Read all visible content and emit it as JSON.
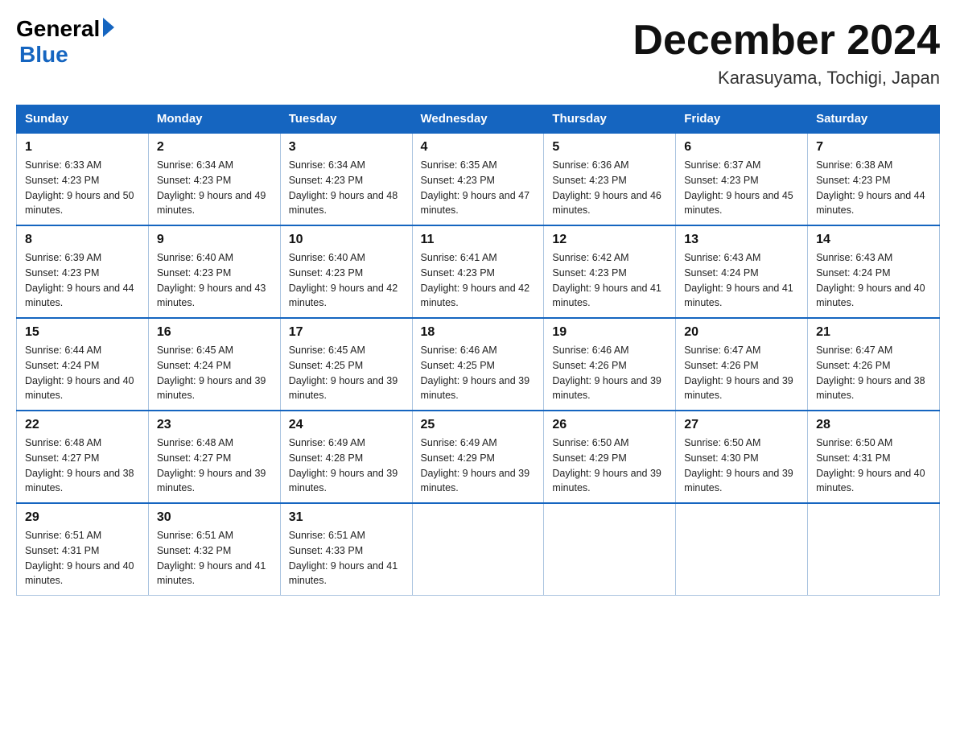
{
  "header": {
    "logo_general": "General",
    "logo_blue": "Blue",
    "title": "December 2024",
    "subtitle": "Karasuyama, Tochigi, Japan"
  },
  "days_of_week": [
    "Sunday",
    "Monday",
    "Tuesday",
    "Wednesday",
    "Thursday",
    "Friday",
    "Saturday"
  ],
  "weeks": [
    [
      {
        "day": 1,
        "sunrise": "6:33 AM",
        "sunset": "4:23 PM",
        "daylight": "9 hours and 50 minutes."
      },
      {
        "day": 2,
        "sunrise": "6:34 AM",
        "sunset": "4:23 PM",
        "daylight": "9 hours and 49 minutes."
      },
      {
        "day": 3,
        "sunrise": "6:34 AM",
        "sunset": "4:23 PM",
        "daylight": "9 hours and 48 minutes."
      },
      {
        "day": 4,
        "sunrise": "6:35 AM",
        "sunset": "4:23 PM",
        "daylight": "9 hours and 47 minutes."
      },
      {
        "day": 5,
        "sunrise": "6:36 AM",
        "sunset": "4:23 PM",
        "daylight": "9 hours and 46 minutes."
      },
      {
        "day": 6,
        "sunrise": "6:37 AM",
        "sunset": "4:23 PM",
        "daylight": "9 hours and 45 minutes."
      },
      {
        "day": 7,
        "sunrise": "6:38 AM",
        "sunset": "4:23 PM",
        "daylight": "9 hours and 44 minutes."
      }
    ],
    [
      {
        "day": 8,
        "sunrise": "6:39 AM",
        "sunset": "4:23 PM",
        "daylight": "9 hours and 44 minutes."
      },
      {
        "day": 9,
        "sunrise": "6:40 AM",
        "sunset": "4:23 PM",
        "daylight": "9 hours and 43 minutes."
      },
      {
        "day": 10,
        "sunrise": "6:40 AM",
        "sunset": "4:23 PM",
        "daylight": "9 hours and 42 minutes."
      },
      {
        "day": 11,
        "sunrise": "6:41 AM",
        "sunset": "4:23 PM",
        "daylight": "9 hours and 42 minutes."
      },
      {
        "day": 12,
        "sunrise": "6:42 AM",
        "sunset": "4:23 PM",
        "daylight": "9 hours and 41 minutes."
      },
      {
        "day": 13,
        "sunrise": "6:43 AM",
        "sunset": "4:24 PM",
        "daylight": "9 hours and 41 minutes."
      },
      {
        "day": 14,
        "sunrise": "6:43 AM",
        "sunset": "4:24 PM",
        "daylight": "9 hours and 40 minutes."
      }
    ],
    [
      {
        "day": 15,
        "sunrise": "6:44 AM",
        "sunset": "4:24 PM",
        "daylight": "9 hours and 40 minutes."
      },
      {
        "day": 16,
        "sunrise": "6:45 AM",
        "sunset": "4:24 PM",
        "daylight": "9 hours and 39 minutes."
      },
      {
        "day": 17,
        "sunrise": "6:45 AM",
        "sunset": "4:25 PM",
        "daylight": "9 hours and 39 minutes."
      },
      {
        "day": 18,
        "sunrise": "6:46 AM",
        "sunset": "4:25 PM",
        "daylight": "9 hours and 39 minutes."
      },
      {
        "day": 19,
        "sunrise": "6:46 AM",
        "sunset": "4:26 PM",
        "daylight": "9 hours and 39 minutes."
      },
      {
        "day": 20,
        "sunrise": "6:47 AM",
        "sunset": "4:26 PM",
        "daylight": "9 hours and 39 minutes."
      },
      {
        "day": 21,
        "sunrise": "6:47 AM",
        "sunset": "4:26 PM",
        "daylight": "9 hours and 38 minutes."
      }
    ],
    [
      {
        "day": 22,
        "sunrise": "6:48 AM",
        "sunset": "4:27 PM",
        "daylight": "9 hours and 38 minutes."
      },
      {
        "day": 23,
        "sunrise": "6:48 AM",
        "sunset": "4:27 PM",
        "daylight": "9 hours and 39 minutes."
      },
      {
        "day": 24,
        "sunrise": "6:49 AM",
        "sunset": "4:28 PM",
        "daylight": "9 hours and 39 minutes."
      },
      {
        "day": 25,
        "sunrise": "6:49 AM",
        "sunset": "4:29 PM",
        "daylight": "9 hours and 39 minutes."
      },
      {
        "day": 26,
        "sunrise": "6:50 AM",
        "sunset": "4:29 PM",
        "daylight": "9 hours and 39 minutes."
      },
      {
        "day": 27,
        "sunrise": "6:50 AM",
        "sunset": "4:30 PM",
        "daylight": "9 hours and 39 minutes."
      },
      {
        "day": 28,
        "sunrise": "6:50 AM",
        "sunset": "4:31 PM",
        "daylight": "9 hours and 40 minutes."
      }
    ],
    [
      {
        "day": 29,
        "sunrise": "6:51 AM",
        "sunset": "4:31 PM",
        "daylight": "9 hours and 40 minutes."
      },
      {
        "day": 30,
        "sunrise": "6:51 AM",
        "sunset": "4:32 PM",
        "daylight": "9 hours and 41 minutes."
      },
      {
        "day": 31,
        "sunrise": "6:51 AM",
        "sunset": "4:33 PM",
        "daylight": "9 hours and 41 minutes."
      },
      null,
      null,
      null,
      null
    ]
  ]
}
